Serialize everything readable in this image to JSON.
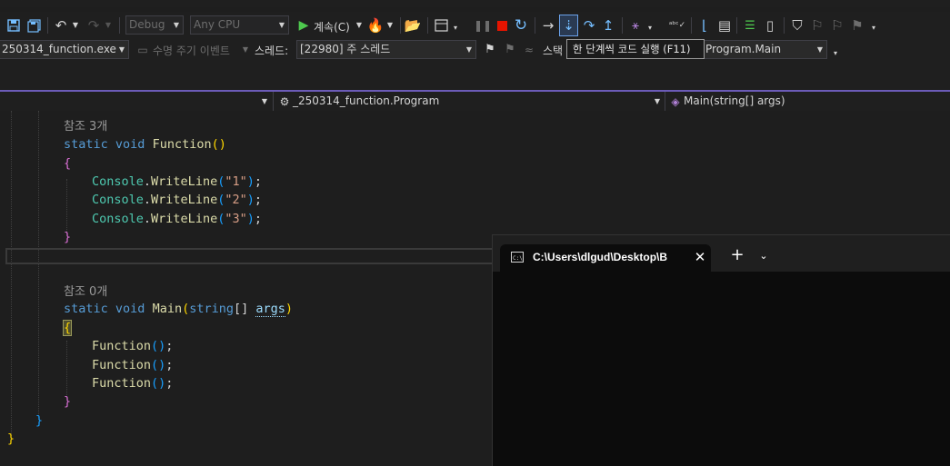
{
  "toolbar": {
    "config": "Debug",
    "platform": "Any CPU",
    "continue_label": "계속(C)",
    "tooltip": "한 단계씩 코드 실행 (F11)"
  },
  "debug_location": {
    "process": "250314_function.exe",
    "lifecycle_events": "수명 주기 이벤트",
    "thread_label": "스레드:",
    "thread_value": "[22980] 주 스레드",
    "stack_label": "스택",
    "stack_frame": "Program.Main"
  },
  "navigation": {
    "type": "_250314_function.Program",
    "member": "Main(string[] args)"
  },
  "code": {
    "ref3": "참조 3개",
    "ref0": "참조 0개",
    "kw_static": "static",
    "kw_void": "void",
    "kw_string": "string",
    "fn_function": "Function",
    "fn_main": "Main",
    "cls_console": "Console",
    "fn_writeline": "WriteLine",
    "str1": "\"1\"",
    "str2": "\"2\"",
    "str3": "\"3\"",
    "param_args": "args"
  },
  "terminal": {
    "tab_title": "C:\\Users\\dlgud\\Desktop\\B"
  }
}
